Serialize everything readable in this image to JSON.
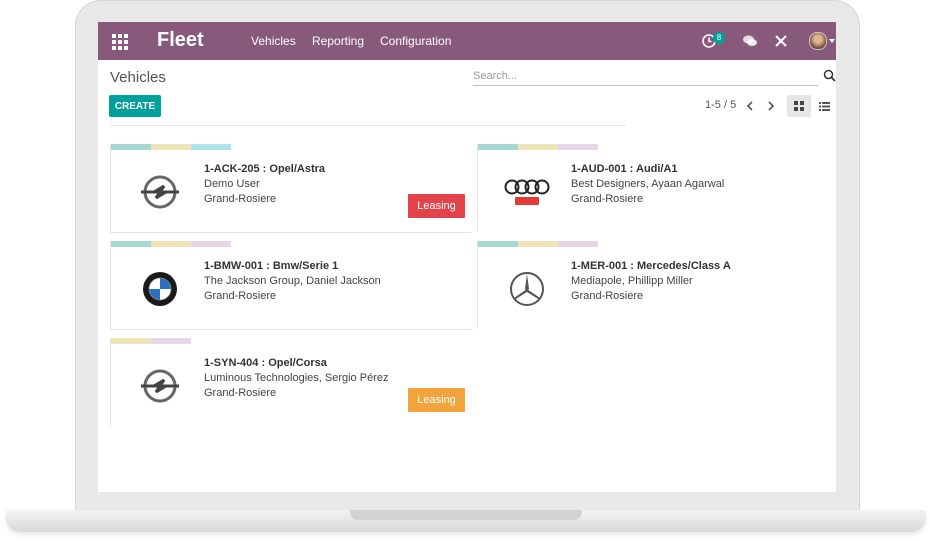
{
  "navbar": {
    "brand": "Fleet",
    "menu": [
      "Vehicles",
      "Reporting",
      "Configuration"
    ],
    "activity_count": "8",
    "icons": [
      "apps-grid-icon",
      "clock-icon",
      "chat-bubbles-icon",
      "close-tools-icon",
      "user-avatar"
    ]
  },
  "control_panel": {
    "title": "Vehicles",
    "search_placeholder": "Search...",
    "create_label": "CREATE",
    "pager": "1-5 / 5"
  },
  "colors": {
    "navbar": "#875a7b",
    "primary": "#00a09d",
    "leasing_red": "#e4434b",
    "leasing_orange": "#f4a23c"
  },
  "cards": [
    {
      "title": "1-ACK-205 : Opel/Astra",
      "line1": "Demo User",
      "line2": "Grand-Rosiere",
      "logo": "opel-logo",
      "tags": [
        "#a4d8d2",
        "#efe4b8",
        "#aee3ea"
      ],
      "badge": "Leasing",
      "badge_color": "#e4434b"
    },
    {
      "title": "1-AUD-001 : Audi/A1",
      "line1": "Best Designers, Ayaan Agarwal",
      "line2": "Grand-Rosiere",
      "logo": "audi-logo",
      "tags": [
        "#a4d8d2",
        "#efe4b8",
        "#e8d6e6"
      ]
    },
    {
      "title": "1-BMW-001 : Bmw/Serie 1",
      "line1": "The Jackson Group, Daniel Jackson",
      "line2": "Grand-Rosiere",
      "logo": "bmw-logo",
      "tags": [
        "#a4d8d2",
        "#efe4b8",
        "#e8d6e6"
      ]
    },
    {
      "title": "1-MER-001 : Mercedes/Class A",
      "line1": "Mediapole, Phillipp Miller",
      "line2": "Grand-Rosiere",
      "logo": "mercedes-logo",
      "tags": [
        "#a4d8d2",
        "#efe4b8",
        "#e8d6e6"
      ]
    },
    {
      "title": "1-SYN-404 : Opel/Corsa",
      "line1": "Luminous Technologies, Sergio Pérez",
      "line2": "Grand-Rosiere",
      "logo": "opel-logo",
      "tags": [
        "#efe4b8",
        "#e8d6e6"
      ],
      "badge": "Leasing",
      "badge_color": "#f4a23c"
    }
  ]
}
